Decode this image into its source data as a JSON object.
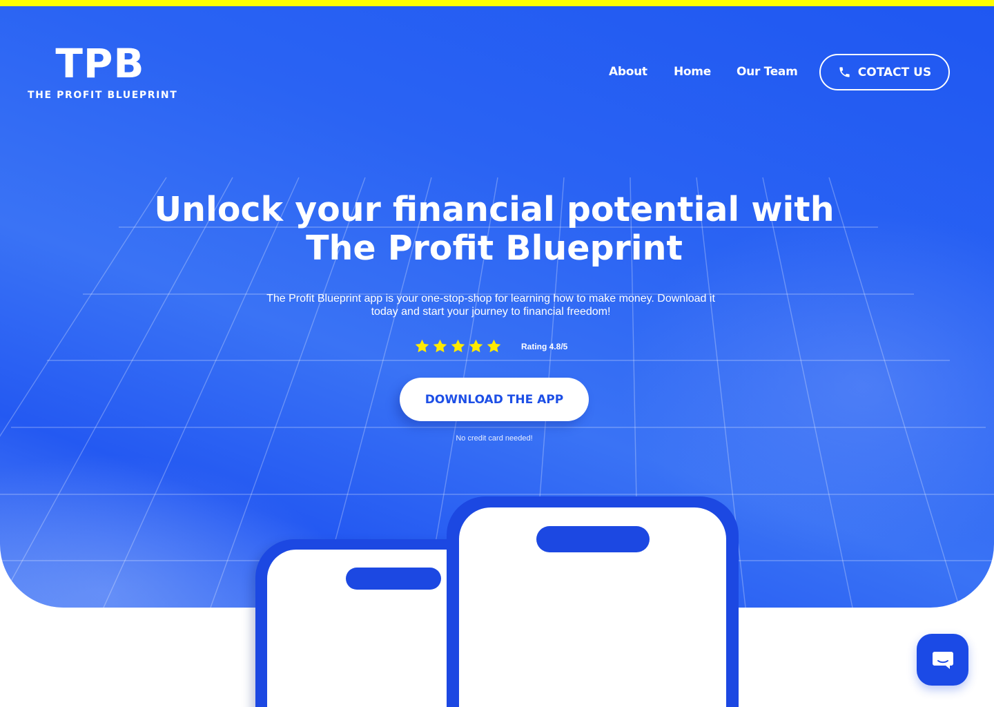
{
  "brand": {
    "mark": "TPB",
    "name": "THE PROFIT BLUEPRINT"
  },
  "nav": {
    "about": "About",
    "home": "Home",
    "team": "Our Team",
    "contact": "COTACT US"
  },
  "hero": {
    "headline": "Unlock your financial potential with The Profit Blueprint",
    "subtext": "The Profit Blueprint app is your one-stop-shop for learning how to make money. Download it today and start your journey to financial freedom!",
    "rating_label": "Rating 4.8/5",
    "stars_filled": 5,
    "cta": "DOWNLOAD THE APP",
    "note": "No credit card needed!"
  },
  "colors": {
    "primary_blue": "#1f57f2",
    "accent_yellow": "#ffff00",
    "star_yellow": "#ffeb00",
    "white": "#ffffff"
  },
  "icons": {
    "contact": "phone-icon",
    "star": "star-icon",
    "chat": "chat-bubble-icon"
  }
}
